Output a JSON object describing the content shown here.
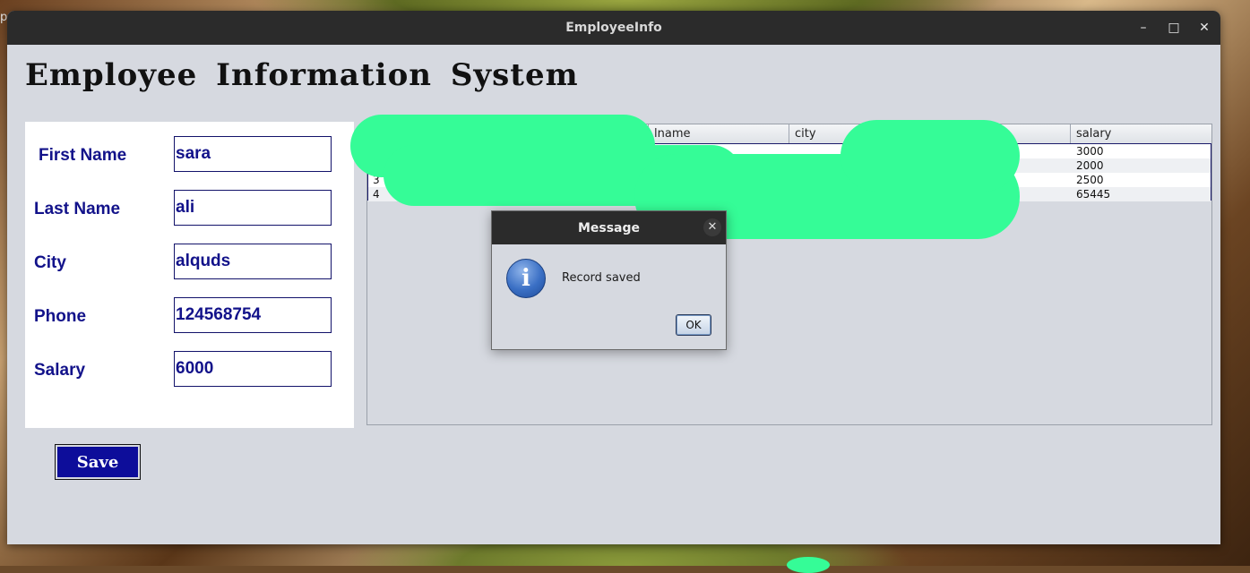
{
  "desktop": {
    "corner_label": "p"
  },
  "window": {
    "title": "EmployeeInfo",
    "minimize_glyph": "–",
    "maximize_glyph": "□",
    "close_glyph": "✕"
  },
  "heading": "Employee  Information  System",
  "form": {
    "fields": [
      {
        "label": "First Name",
        "value": "sara"
      },
      {
        "label": "Last Name",
        "value": "ali"
      },
      {
        "label": "City",
        "value": "alquds"
      },
      {
        "label": "Phone",
        "value": "124568754"
      },
      {
        "label": "Salary",
        "value": "6000"
      }
    ],
    "save_label": "Save"
  },
  "table": {
    "columns": [
      "",
      "lname",
      "city",
      "",
      "salary"
    ],
    "rows": [
      {
        "id": "",
        "salary": "3000"
      },
      {
        "id": "",
        "salary": "2000"
      },
      {
        "id": "3",
        "salary": "2500"
      },
      {
        "id": "4",
        "salary": "65445"
      }
    ]
  },
  "dialog": {
    "title": "Message",
    "close_glyph": "✕",
    "icon": "info-icon",
    "icon_glyph": "i",
    "message": "Record saved",
    "ok_label": "OK"
  },
  "colors": {
    "label_text": "#12128a",
    "save_button": "#0d0d9a",
    "redaction": "#35fc97"
  }
}
